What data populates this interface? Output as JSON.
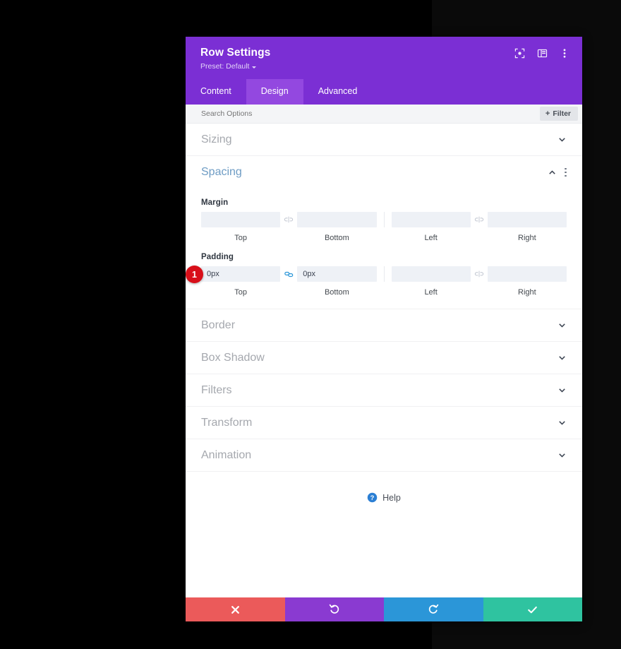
{
  "window": {
    "title": "Row Settings",
    "preset_label": "Preset: Default",
    "header_icons": [
      {
        "name": "focus-icon",
        "title": "Focus"
      },
      {
        "name": "layout-panel-icon",
        "title": "Panel Layout"
      },
      {
        "name": "kebab-menu-icon",
        "title": "More Options"
      }
    ]
  },
  "tabs": [
    {
      "label": "Content",
      "active": false
    },
    {
      "label": "Design",
      "active": true
    },
    {
      "label": "Advanced",
      "active": false
    }
  ],
  "search": {
    "placeholder": "Search Options",
    "value": "",
    "filter_label": "Filter",
    "filter_plus": "+"
  },
  "sections": [
    {
      "label": "Sizing",
      "open": false
    },
    {
      "label": "Spacing",
      "open": true
    },
    {
      "label": "Border",
      "open": false
    },
    {
      "label": "Box Shadow",
      "open": false
    },
    {
      "label": "Filters",
      "open": false
    },
    {
      "label": "Transform",
      "open": false
    },
    {
      "label": "Animation",
      "open": false
    }
  ],
  "spacing": {
    "margin": {
      "label": "Margin",
      "link_state": "unlinked",
      "fields": [
        {
          "caption": "Top",
          "value": "",
          "placeholder": ""
        },
        {
          "caption": "Bottom",
          "value": "",
          "placeholder": ""
        },
        {
          "caption": "Left",
          "value": "",
          "placeholder": ""
        },
        {
          "caption": "Right",
          "value": "",
          "placeholder": ""
        }
      ]
    },
    "padding": {
      "label": "Padding",
      "link_state": "linked",
      "badge": "1",
      "fields": [
        {
          "caption": "Top",
          "value": "0px",
          "placeholder": ""
        },
        {
          "caption": "Bottom",
          "value": "0px",
          "placeholder": ""
        },
        {
          "caption": "Left",
          "value": "",
          "placeholder": ""
        },
        {
          "caption": "Right",
          "value": "",
          "placeholder": ""
        }
      ]
    }
  },
  "help": {
    "label": "Help",
    "icon": "question-circle-icon"
  },
  "footer": [
    {
      "name": "cancel-button",
      "icon": "close-icon",
      "color": "#eb5a5a"
    },
    {
      "name": "undo-button",
      "icon": "undo-icon",
      "color": "#8a3ad1"
    },
    {
      "name": "redo-button",
      "icon": "redo-icon",
      "color": "#2b96d8"
    },
    {
      "name": "save-button",
      "icon": "check-icon",
      "color": "#2fc3a0"
    }
  ],
  "colors": {
    "header_purple": "#7b2fd4",
    "tab_active_purple": "#9348e0",
    "section_open_blue": "#6e9cc4",
    "badge_red": "#d80f19",
    "link_active_blue": "#2b96d8"
  }
}
